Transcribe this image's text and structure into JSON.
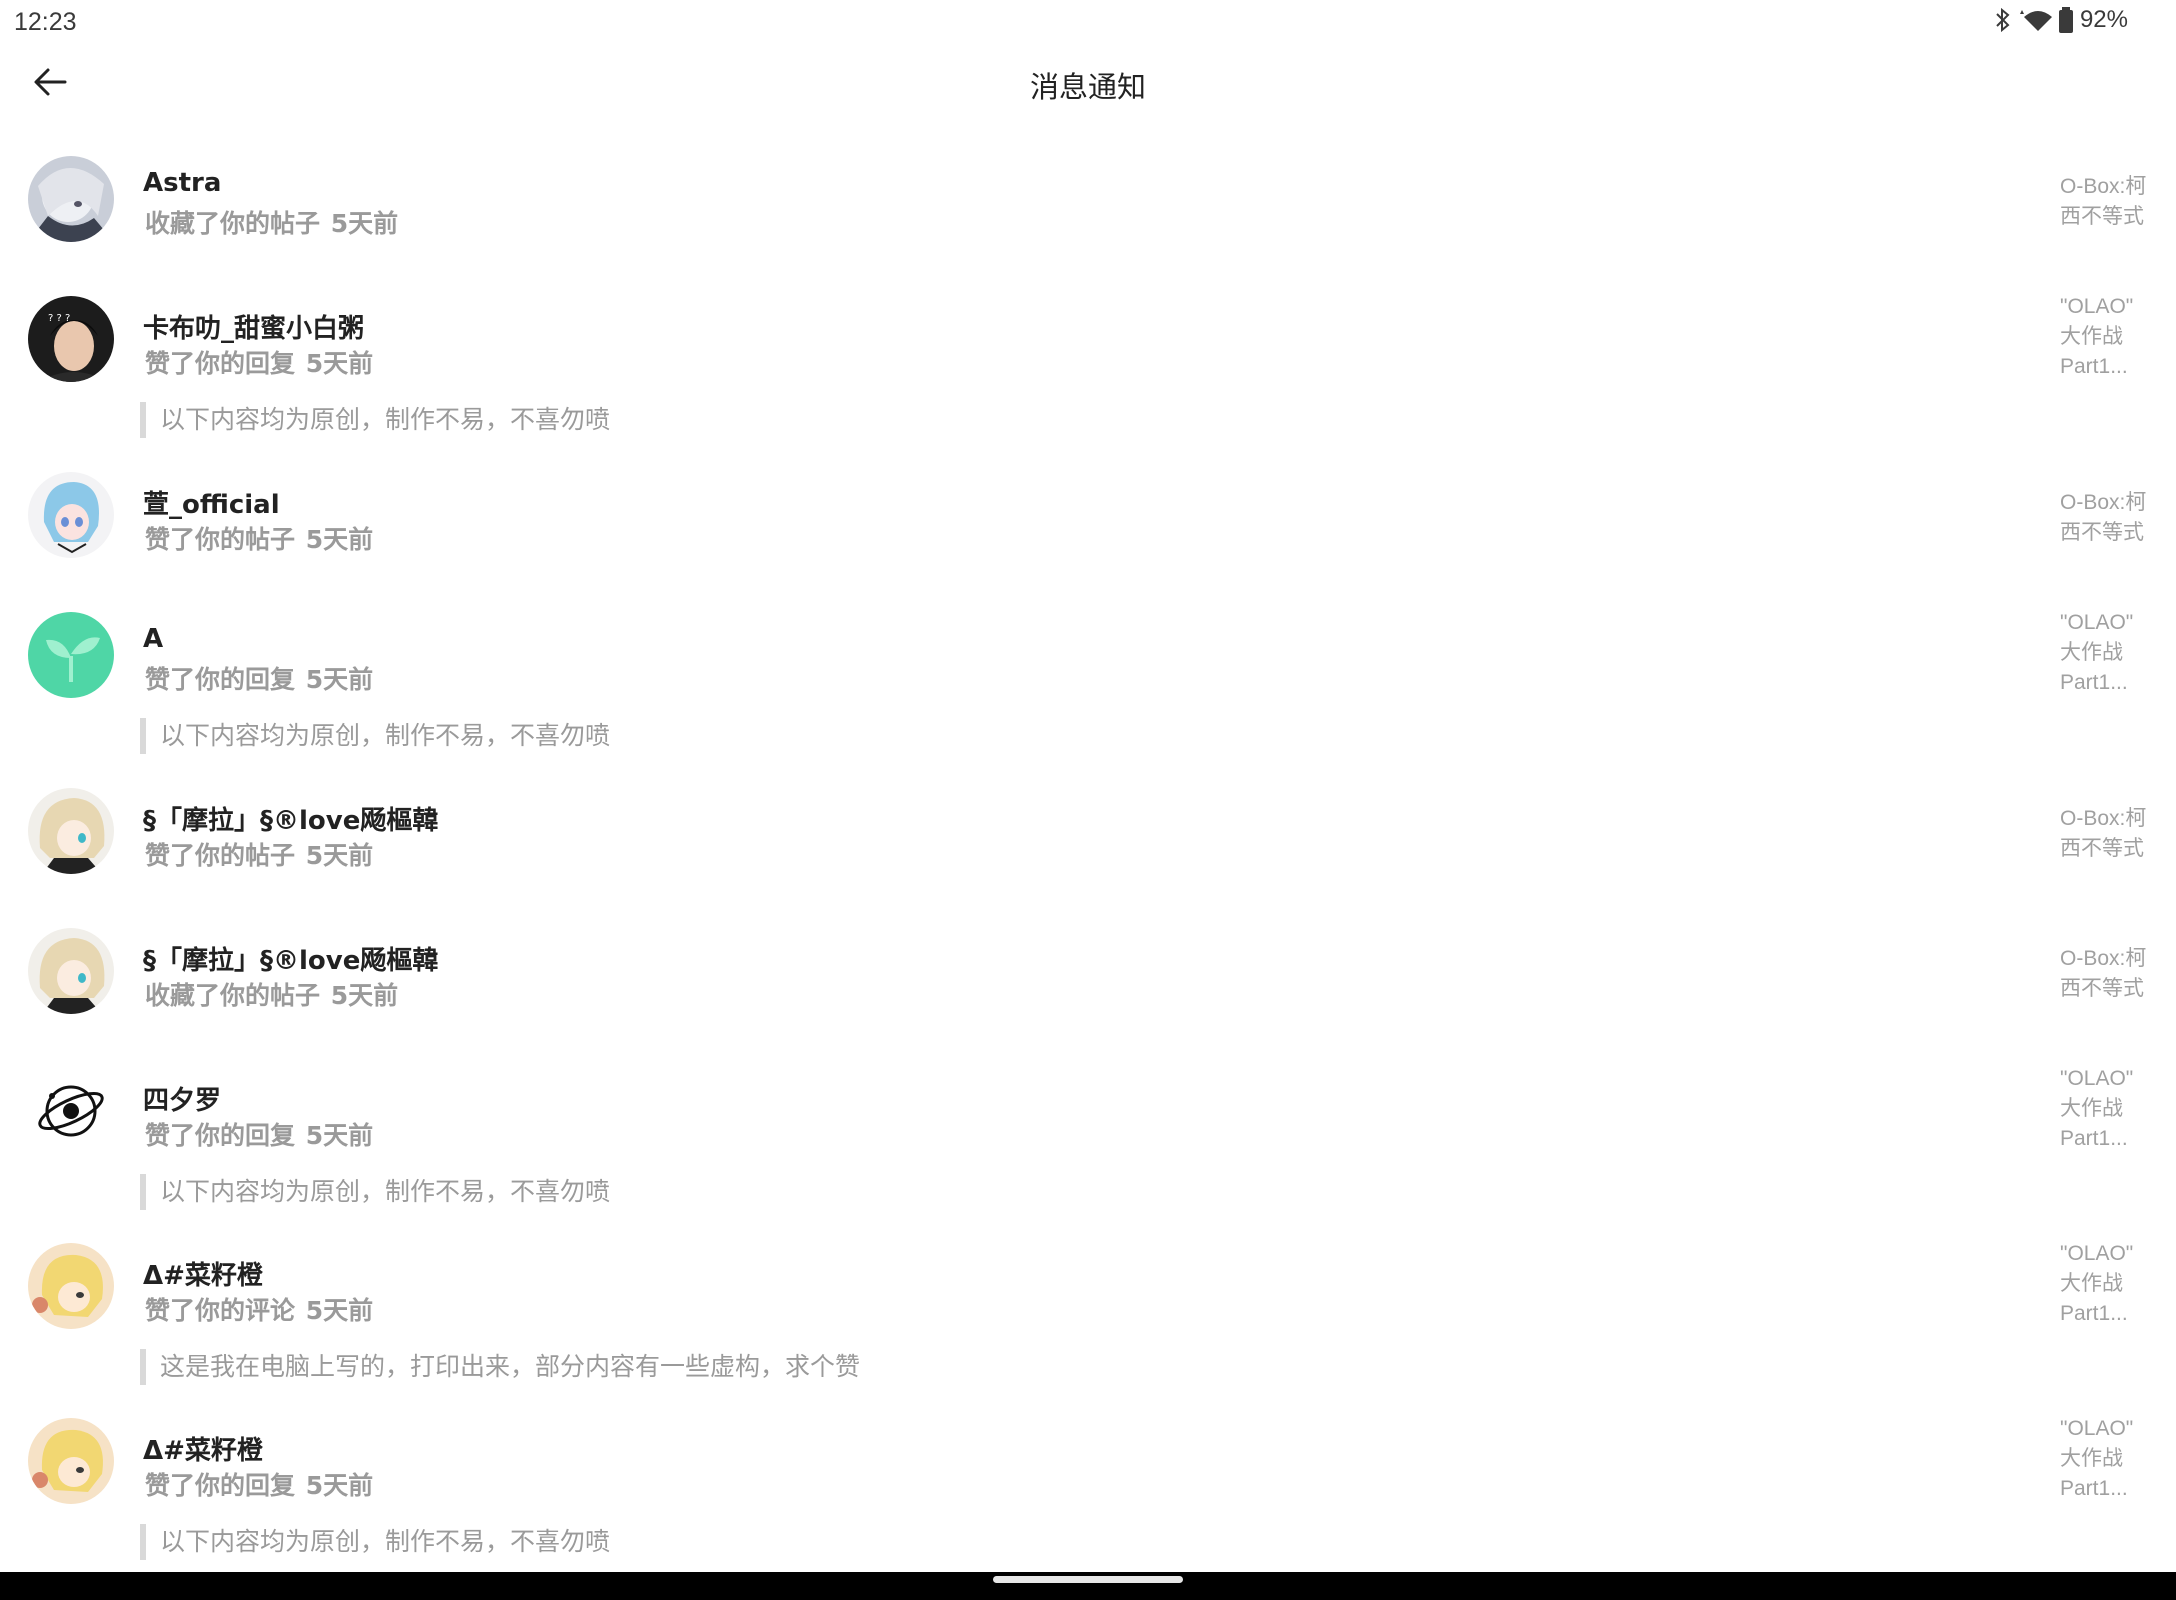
{
  "status_bar": {
    "time": "12:23",
    "battery": "92%",
    "icons": [
      "bluetooth-icon",
      "wifi-icon",
      "battery-icon"
    ]
  },
  "header": {
    "title": "消息通知",
    "back_icon": "arrow-left-icon"
  },
  "notifications": [
    {
      "name": "Astra",
      "action": "收藏了你的帖子",
      "time": "5天前",
      "quote": "",
      "post": "O-Box:柯\n西不等式",
      "avatar": "anime-portrait-avatar"
    },
    {
      "name": "卡布叻_甜蜜小白粥",
      "action": "赞了你的回复",
      "time": "5天前",
      "quote": "以下内容均为原创，制作不易，不喜勿喷",
      "post": "\"OLAO\"\n大作战\nPart1...",
      "avatar": "photo-portrait-avatar"
    },
    {
      "name": "萱_official",
      "action": "赞了你的帖子",
      "time": "5天前",
      "quote": "",
      "post": "O-Box:柯\n西不等式",
      "avatar": "blue-hair-anime-avatar"
    },
    {
      "name": "A",
      "action": "赞了你的回复",
      "time": "5天前",
      "quote": "以下内容均为原创，制作不易，不喜勿喷",
      "post": "\"OLAO\"\n大作战\nPart1...",
      "avatar": "sprout-avatar"
    },
    {
      "name": "§「摩拉」§®love飏樞韓",
      "action": "赞了你的帖子",
      "time": "5天前",
      "quote": "",
      "post": "O-Box:柯\n西不等式",
      "avatar": "blonde-anime-avatar"
    },
    {
      "name": "§「摩拉」§®love飏樞韓",
      "action": "收藏了你的帖子",
      "time": "5天前",
      "quote": "",
      "post": "O-Box:柯\n西不等式",
      "avatar": "blonde-anime-avatar"
    },
    {
      "name": "四夕罗",
      "action": "赞了你的回复",
      "time": "5天前",
      "quote": "以下内容均为原创，制作不易，不喜勿喷",
      "post": "\"OLAO\"\n大作战\nPart1...",
      "avatar": "orbit-logo-avatar"
    },
    {
      "name": "Δ#菜籽橙",
      "action": "赞了你的评论",
      "time": "5天前",
      "quote": "这是我在电脑上写的，打印出来，部分内容有一些虚构，求个赞",
      "post": "\"OLAO\"\n大作战\nPart1...",
      "avatar": "yellow-character-avatar"
    },
    {
      "name": "Δ#菜籽橙",
      "action": "赞了你的回复",
      "time": "5天前",
      "quote": "以下内容均为原创，制作不易，不喜勿喷",
      "post": "\"OLAO\"\n大作战\nPart1...",
      "avatar": "yellow-character-avatar"
    }
  ]
}
